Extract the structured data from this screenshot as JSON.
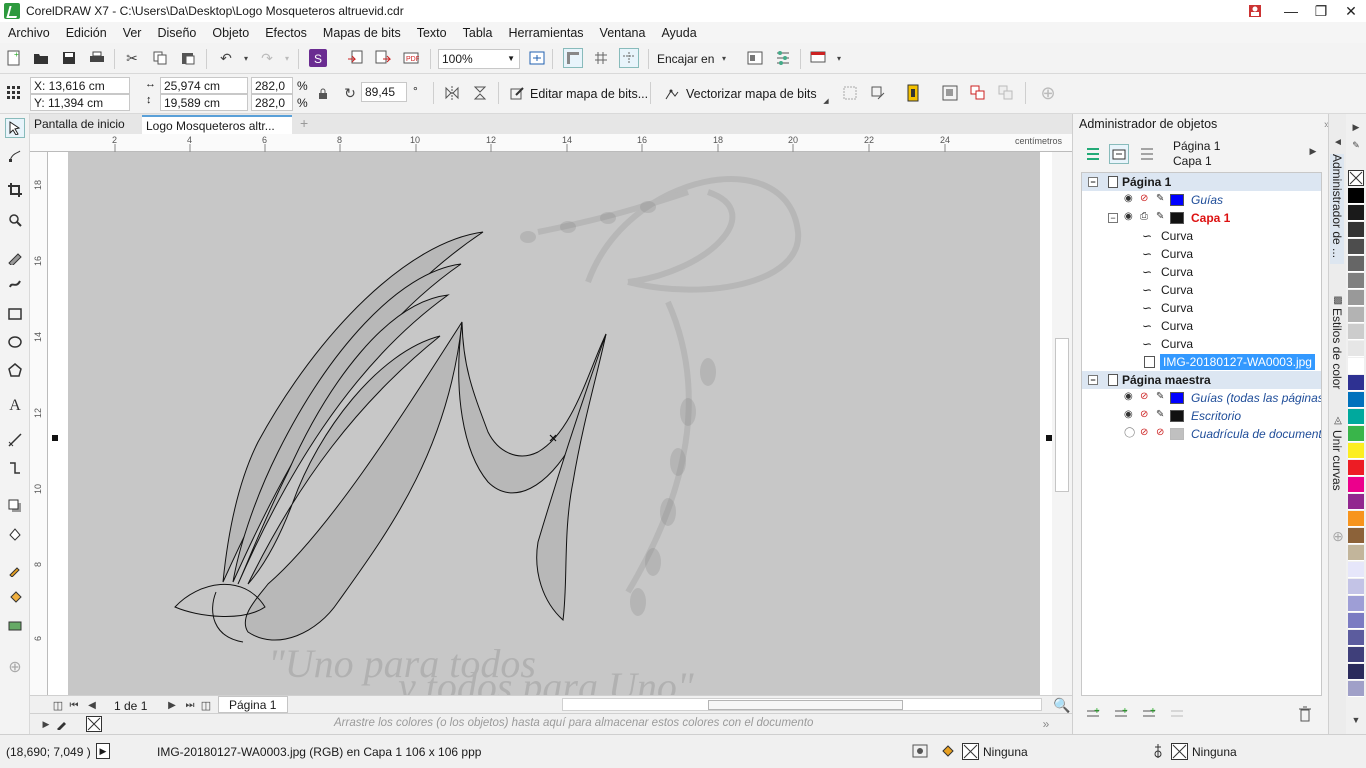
{
  "window": {
    "title": "CorelDRAW X7 - C:\\Users\\Da\\Desktop\\Logo Mosqueteros altruevid.cdr"
  },
  "menu": [
    "Archivo",
    "Edición",
    "Ver",
    "Diseño",
    "Objeto",
    "Efectos",
    "Mapas de bits",
    "Texto",
    "Tabla",
    "Herramientas",
    "Ventana",
    "Ayuda"
  ],
  "toolbar1": {
    "zoom": "100%",
    "snap_label": "Encajar en"
  },
  "propertybar": {
    "x": "X: 13,616 cm",
    "y": "Y: 11,394 cm",
    "width": "25,974 cm",
    "height": "19,589 cm",
    "scale_w": "282,0",
    "scale_h": "282,0",
    "pct": "%",
    "rotation": "89,45",
    "degree": "°",
    "edit_bitmap": "Editar mapa de bits...",
    "trace_bitmap": "Vectorizar mapa de bits"
  },
  "tabs": [
    "Pantalla de inicio",
    "Logo Mosqueteros altr..."
  ],
  "ruler": {
    "units": "centímetros",
    "h_ticks": [
      "2",
      "4",
      "6",
      "8",
      "10",
      "12",
      "14",
      "16",
      "18",
      "20",
      "22",
      "24"
    ],
    "v_ticks": [
      "18",
      "16",
      "14",
      "12",
      "10",
      "8",
      "6"
    ]
  },
  "pagenav": {
    "counter": "1 de 1",
    "page_tab": "Página 1"
  },
  "palette_hint": "Arrastre los colores (o los objetos) hasta aquí para almacenar estos colores con el documento",
  "status": {
    "coords": "(18,690; 7,049 )",
    "info": "IMG-20180127-WA0003.jpg (RGB) en Capa 1 106 x 106 ppp",
    "fill": "Ninguna",
    "outline": "Ninguna"
  },
  "docker": {
    "title": "Administrador de objetos",
    "page": "Página 1",
    "layer": "Capa 1",
    "tree": {
      "page1": "Página 1",
      "guides": "Guías",
      "layer1": "Capa 1",
      "curves": [
        "Curva",
        "Curva",
        "Curva",
        "Curva",
        "Curva",
        "Curva",
        "Curva"
      ],
      "image": "IMG-20180127-WA0003.jpg",
      "master": "Página maestra",
      "master_guides": "Guías (todas las páginas)",
      "desktop": "Escritorio",
      "grid": "Cuadrícula de documento"
    },
    "colors": {
      "guides": "#0000ff",
      "layer1": "#111111",
      "desktop": "#111111",
      "grid": "#c0c0c0"
    }
  },
  "sidetabs": [
    "Administrador de ...",
    "Estilos de color",
    "Unir curvas"
  ],
  "palette_colors": [
    "#000000",
    "#1a1a1a",
    "#333333",
    "#4d4d4d",
    "#666666",
    "#808080",
    "#999999",
    "#b3b3b3",
    "#cccccc",
    "#e6e6e6",
    "#ffffff",
    "#2e3192",
    "#0071bc",
    "#00a99d",
    "#39b54a",
    "#fcee21",
    "#ed1c24",
    "#ec008c",
    "#92278f",
    "#f7941d",
    "#8c6239",
    "#c2b59b",
    "#e6e6fa",
    "#c3c3e6",
    "#9e9ed6",
    "#7b7bc2",
    "#5c5c9e",
    "#3f3f7a",
    "#2b2b5c",
    "#a0a0c8"
  ]
}
